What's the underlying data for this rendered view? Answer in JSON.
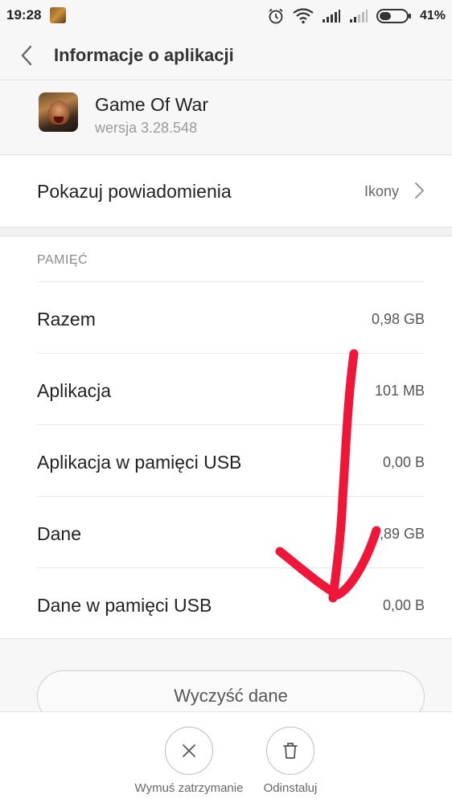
{
  "status_bar": {
    "time": "19:28",
    "battery_percent": "41%",
    "icons": [
      "alarm-icon",
      "wifi-icon",
      "signal-icon",
      "signal-icon",
      "battery-icon"
    ]
  },
  "header": {
    "title": "Informacje o aplikacji"
  },
  "app": {
    "name": "Game Of War",
    "version": "wersja 3.28.548"
  },
  "notifications": {
    "label": "Pokazuj powiadomienia",
    "value": "Ikony"
  },
  "storage": {
    "section_title": "PAMIĘĆ",
    "rows": [
      {
        "label": "Razem",
        "value": "0,98 GB"
      },
      {
        "label": "Aplikacja",
        "value": "101 MB"
      },
      {
        "label": "Aplikacja w pamięci USB",
        "value": "0,00 B"
      },
      {
        "label": "Dane",
        "value": "0,89 GB"
      },
      {
        "label": "Dane w pamięci USB",
        "value": "0,00 B"
      }
    ]
  },
  "actions": {
    "clear_data": "Wyczyść dane",
    "force_stop": "Wymuś zatrzymanie",
    "uninstall": "Odinstaluj"
  },
  "colors": {
    "annotation_arrow": "#f0163a",
    "background": "#f7f7f7"
  }
}
